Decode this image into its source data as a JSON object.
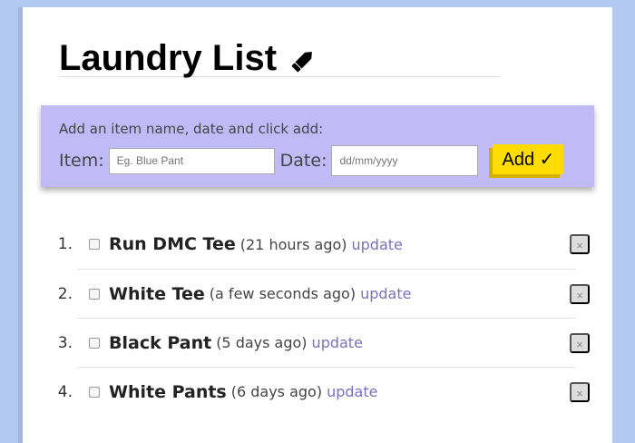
{
  "title": "Laundry List",
  "form": {
    "hint": "Add an item name, date and click add:",
    "item_label": "Item:",
    "item_placeholder": "Eg. Blue Pant",
    "date_label": "Date:",
    "date_placeholder": "dd/mm/yyyy",
    "add_label": "Add ✓"
  },
  "items": [
    {
      "num": "1.",
      "name": "Run DMC Tee",
      "ago": "(21 hours ago)",
      "update": "update",
      "delete": "×"
    },
    {
      "num": "2.",
      "name": "White Tee",
      "ago": "(a few seconds ago)",
      "update": "update",
      "delete": "×"
    },
    {
      "num": "3.",
      "name": "Black Pant",
      "ago": "(5 days ago)",
      "update": "update",
      "delete": "×"
    },
    {
      "num": "4.",
      "name": "White Pants",
      "ago": "(6 days ago)",
      "update": "update",
      "delete": "×"
    }
  ]
}
